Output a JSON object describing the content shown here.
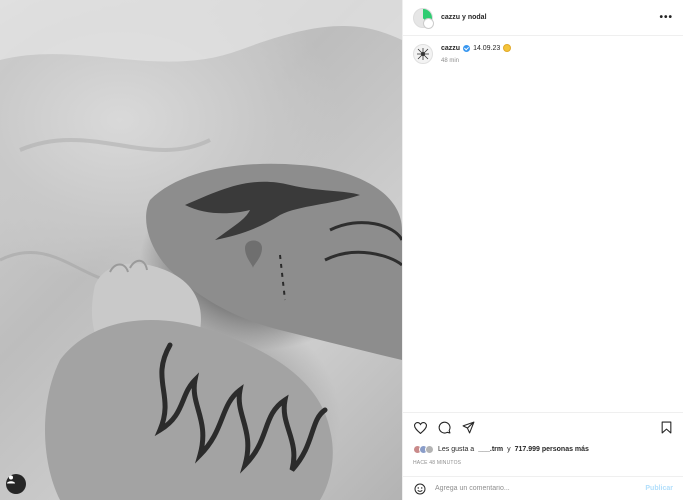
{
  "post": {
    "photo_alt": "photo"
  },
  "header": {
    "title": "cazzu y nodal",
    "more": "•••"
  },
  "caption": {
    "username": "cazzu",
    "text": "14.09.23",
    "time": "48 min"
  },
  "likes": {
    "prefix": "Les gusta a",
    "user": "___.trm",
    "middle": "y",
    "count": "717.999 personas más"
  },
  "ago": "HACE 48 MINUTOS",
  "comment": {
    "placeholder": "Agrega un comentario...",
    "publish": "Publicar"
  },
  "icons": {
    "like": "heart-icon",
    "comment": "comment-icon",
    "share": "share-icon",
    "save": "bookmark-icon",
    "emoji": "emoji-icon",
    "tag": "user-tag-icon"
  }
}
